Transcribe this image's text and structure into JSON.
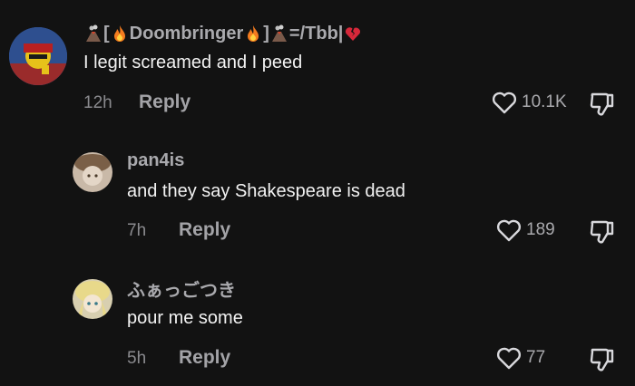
{
  "comments": [
    {
      "username_parts": {
        "open_bracket": "[",
        "name": "Doombringer",
        "close_bracket": "]",
        "suffix": "=/Tbb|"
      },
      "text": "I legit screamed and I peed",
      "time": "12h",
      "reply_label": "Reply",
      "likes": "10.1K",
      "icons": [
        "volcano-icon",
        "fire-icon",
        "broken-heart-icon",
        "heart-icon",
        "dislike-icon"
      ]
    },
    {
      "username": "pan4is",
      "text": "and they say Shakespeare is dead",
      "time": "7h",
      "reply_label": "Reply",
      "likes": "189",
      "icons": [
        "heart-icon",
        "dislike-icon"
      ]
    },
    {
      "username": "ふぁっごつき",
      "text": "pour me some",
      "time": "5h",
      "reply_label": "Reply",
      "likes": "77",
      "icons": [
        "heart-icon",
        "dislike-icon"
      ]
    }
  ],
  "colors": {
    "background": "#121212",
    "username": "#a9a9ad",
    "body_text": "#f2f2f2",
    "meta": "#8a8a8e"
  }
}
